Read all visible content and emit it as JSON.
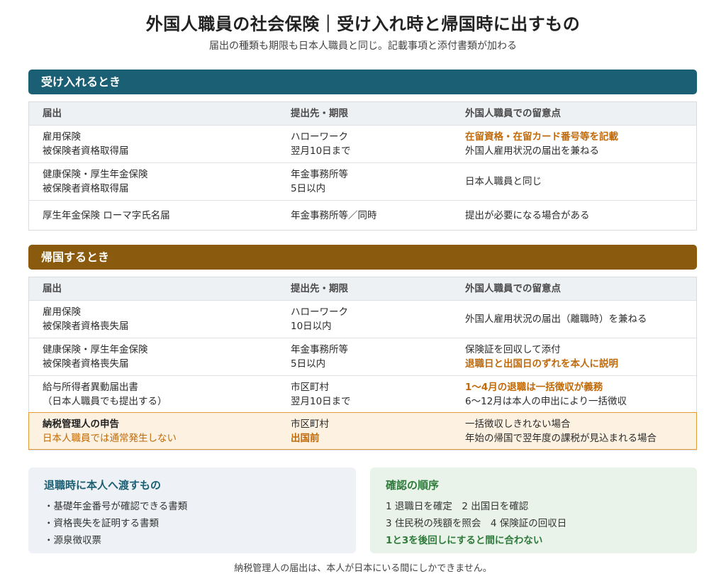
{
  "title": "外国人職員の社会保険｜受け入れ時と帰国時に出すもの",
  "subtitle": "届出の種類も期限も日本人職員と同じ。記載事項と添付書類が加わる",
  "columns": {
    "c1": "届出",
    "c2": "提出先・期限",
    "c3": "外国人職員での留意点"
  },
  "section1": {
    "heading": "受け入れるとき",
    "rows": [
      {
        "a1": "雇用保険",
        "a2": "被保険者資格取得届",
        "b1": "ハローワーク",
        "b2": "翌月10日まで",
        "n1": "在留資格・在留カード番号等を記載",
        "n2": "外国人雇用状況の届出を兼ねる"
      },
      {
        "a1": "健康保険・厚生年金保険",
        "a2": "被保険者資格取得届",
        "b1": "年金事務所等",
        "b2": "5日以内",
        "n1": "日本人職員と同じ"
      },
      {
        "a1": "厚生年金保険 ローマ字氏名届",
        "b1": "年金事務所等／同時",
        "n1": "提出が必要になる場合がある"
      }
    ]
  },
  "section2": {
    "heading": "帰国するとき",
    "rows": [
      {
        "a1": "雇用保険",
        "a2": "被保険者資格喪失届",
        "b1": "ハローワーク",
        "b2": "10日以内",
        "n1": "外国人雇用状況の届出（離職時）を兼ねる"
      },
      {
        "a1": "健康保険・厚生年金保険",
        "a2": "被保険者資格喪失届",
        "b1": "年金事務所等",
        "b2": "5日以内",
        "n1": "保険証を回収して添付",
        "n2": "退職日と出国日のずれを本人に説明"
      },
      {
        "a1": "給与所得者異動届出書",
        "a2": "（日本人職員でも提出する）",
        "b1": "市区町村",
        "b2": "翌月10日まで",
        "n1": "1〜4月の退職は一括徴収が義務",
        "n2": "6〜12月は本人の申出により一括徴収"
      },
      {
        "a1": "納税管理人の申告",
        "a2": "日本人職員では通常発生しない",
        "b1": "市区町村",
        "b2": "出国前",
        "n1": "一括徴収しきれない場合",
        "n2": "年始の帰国で翌年度の課税が見込まれる場合"
      }
    ]
  },
  "handover": {
    "title": "退職時に本人へ渡すもの",
    "items": [
      "・基礎年金番号が確認できる書類",
      "・資格喪失を証明する書類",
      "・源泉徴収票"
    ]
  },
  "order": {
    "title": "確認の順序",
    "line1": "1 退職日を確定　2 出国日を確認",
    "line2": "3 住民税の残額を照会　4 保険証の回収日",
    "warning": "1と3を後回しにすると間に合わない"
  },
  "footer": "納税管理人の届出は、本人が日本にいる間にしかできません。",
  "colors": {
    "teal": "#1a5f73",
    "brown": "#8a5a0e",
    "orange": "#c06a0a",
    "green": "#2f7a3b",
    "highlight": "#fdf2e1"
  }
}
